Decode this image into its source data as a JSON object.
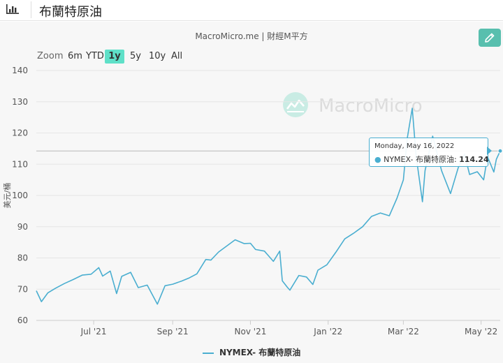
{
  "header": {
    "title": "布蘭特原油"
  },
  "chart_panel": {
    "subtitle": "MacroMicro.me | 財經M平方",
    "edit_button_icon": "pencil-icon",
    "range_selector": {
      "zoom_label": "Zoom",
      "buttons": [
        "6m",
        "YTD",
        "1y",
        "5y",
        "10y",
        "All"
      ],
      "active": "1y"
    },
    "watermark": "MacroMicro"
  },
  "colors": {
    "series_line": "#4aaed0",
    "active_button": "#5fe0c8",
    "edit_button": "#58bfae",
    "gridline": "#e6e6e6",
    "panel_bg": "#f7f7f7"
  },
  "tooltip": {
    "date": "Monday, May 16, 2022",
    "series": "NYMEX- 布蘭特原油",
    "value": "114.24"
  },
  "chart_data": {
    "type": "line",
    "ylabel": "美元/桶",
    "xlabel": "",
    "ylim": [
      60,
      140
    ],
    "yticks": [
      60,
      70,
      80,
      90,
      100,
      110,
      120,
      130,
      140
    ],
    "xticks": [
      {
        "label": "Jul '21",
        "date": "2021-07-01"
      },
      {
        "label": "Sep '21",
        "date": "2021-09-01"
      },
      {
        "label": "Nov '21",
        "date": "2021-11-01"
      },
      {
        "label": "Jan '22",
        "date": "2022-01-01"
      },
      {
        "label": "Mar '22",
        "date": "2022-03-01"
      },
      {
        "label": "May '22",
        "date": "2022-05-01"
      }
    ],
    "grid": true,
    "legend_position": "bottom-center",
    "crosshair_value": 114.24,
    "series": [
      {
        "name": "NYMEX- 布蘭特原油",
        "points": [
          [
            "2021-05-17",
            69.5
          ],
          [
            "2021-05-21",
            66.0
          ],
          [
            "2021-05-26",
            68.8
          ],
          [
            "2021-06-01",
            70.3
          ],
          [
            "2021-06-08",
            71.8
          ],
          [
            "2021-06-15",
            73.1
          ],
          [
            "2021-06-22",
            74.5
          ],
          [
            "2021-06-29",
            74.8
          ],
          [
            "2021-07-05",
            76.9
          ],
          [
            "2021-07-08",
            74.2
          ],
          [
            "2021-07-14",
            75.8
          ],
          [
            "2021-07-19",
            68.6
          ],
          [
            "2021-07-23",
            74.1
          ],
          [
            "2021-07-30",
            75.4
          ],
          [
            "2021-08-05",
            70.5
          ],
          [
            "2021-08-12",
            71.3
          ],
          [
            "2021-08-20",
            65.2
          ],
          [
            "2021-08-26",
            71.1
          ],
          [
            "2021-09-01",
            71.6
          ],
          [
            "2021-09-08",
            72.6
          ],
          [
            "2021-09-14",
            73.6
          ],
          [
            "2021-09-20",
            74.9
          ],
          [
            "2021-09-27",
            79.5
          ],
          [
            "2021-10-01",
            79.3
          ],
          [
            "2021-10-07",
            81.9
          ],
          [
            "2021-10-14",
            84.0
          ],
          [
            "2021-10-20",
            85.8
          ],
          [
            "2021-10-27",
            84.6
          ],
          [
            "2021-11-01",
            84.7
          ],
          [
            "2021-11-05",
            82.7
          ],
          [
            "2021-11-12",
            82.2
          ],
          [
            "2021-11-19",
            78.9
          ],
          [
            "2021-11-24",
            82.2
          ],
          [
            "2021-11-26",
            72.7
          ],
          [
            "2021-11-30",
            70.6
          ],
          [
            "2021-12-02",
            69.7
          ],
          [
            "2021-12-09",
            74.4
          ],
          [
            "2021-12-15",
            73.9
          ],
          [
            "2021-12-20",
            71.5
          ],
          [
            "2021-12-24",
            76.1
          ],
          [
            "2021-12-31",
            77.8
          ],
          [
            "2022-01-07",
            81.8
          ],
          [
            "2022-01-14",
            86.1
          ],
          [
            "2022-01-21",
            87.9
          ],
          [
            "2022-01-28",
            90.0
          ],
          [
            "2022-02-04",
            93.3
          ],
          [
            "2022-02-11",
            94.4
          ],
          [
            "2022-02-18",
            93.5
          ],
          [
            "2022-02-24",
            99.1
          ],
          [
            "2022-03-01",
            105.0
          ],
          [
            "2022-03-04",
            118.1
          ],
          [
            "2022-03-08",
            127.9
          ],
          [
            "2022-03-11",
            112.7
          ],
          [
            "2022-03-16",
            98.0
          ],
          [
            "2022-03-18",
            107.9
          ],
          [
            "2022-03-24",
            119.0
          ],
          [
            "2022-03-31",
            107.9
          ],
          [
            "2022-04-07",
            100.6
          ],
          [
            "2022-04-13",
            108.8
          ],
          [
            "2022-04-18",
            113.2
          ],
          [
            "2022-04-22",
            106.7
          ],
          [
            "2022-04-28",
            107.6
          ],
          [
            "2022-05-03",
            105.0
          ],
          [
            "2022-05-06",
            112.4
          ],
          [
            "2022-05-11",
            107.5
          ],
          [
            "2022-05-13",
            111.6
          ],
          [
            "2022-05-16",
            114.24
          ]
        ]
      }
    ]
  }
}
